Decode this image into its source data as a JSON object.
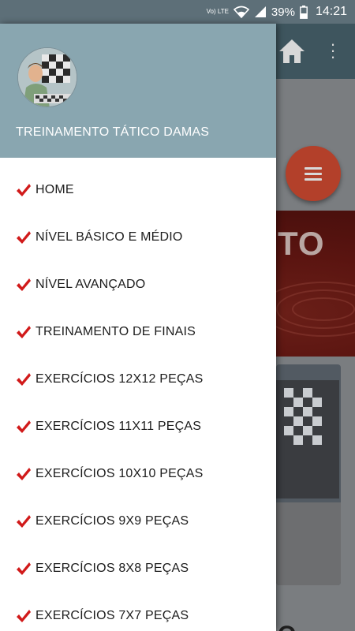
{
  "status_bar": {
    "network": "Vo) LTE",
    "battery": "39%",
    "time": "14:21"
  },
  "background": {
    "banner_text": "TO",
    "card_text": "O",
    "icons": [
      "home-icon",
      "more-vert-icon",
      "menu-icon"
    ]
  },
  "drawer": {
    "header_title": "TREINAMENTO TÁTICO DAMAS",
    "check_icon": "check-icon",
    "check_color": "#d11a1a",
    "items": [
      {
        "label": "HOME"
      },
      {
        "label": "NÍVEL BÁSICO E MÉDIO"
      },
      {
        "label": "NÍVEL AVANÇADO"
      },
      {
        "label": "TREINAMENTO DE FINAIS"
      },
      {
        "label": "EXERCÍCIOS 12X12 PEÇAS"
      },
      {
        "label": "EXERCÍCIOS 11X11 PEÇAS"
      },
      {
        "label": "EXERCÍCIOS 10X10 PEÇAS"
      },
      {
        "label": "EXERCÍCIOS 9X9 PEÇAS"
      },
      {
        "label": "EXERCÍCIOS 8X8 PEÇAS"
      },
      {
        "label": "EXERCÍCIOS 7X7 PEÇAS"
      }
    ]
  }
}
